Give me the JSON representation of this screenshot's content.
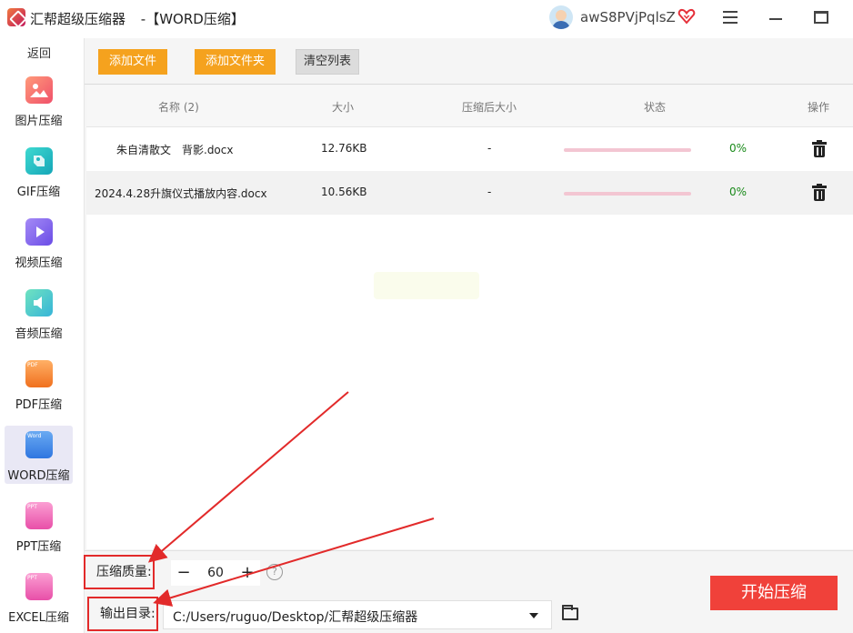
{
  "titlebar": {
    "app_name": "汇帮超级压缩器",
    "mode": "-【WORD压缩】",
    "username": "awS8PVjPqlsZ"
  },
  "sidebar": {
    "back_label": "返回",
    "items": [
      {
        "label": "图片压缩",
        "icon": "image-icon",
        "color": "#f47c6c"
      },
      {
        "label": "GIF压缩",
        "icon": "gif-icon",
        "color": "#2ec5c0"
      },
      {
        "label": "视频压缩",
        "icon": "video-icon",
        "color": "#8b6cf0"
      },
      {
        "label": "音频压缩",
        "icon": "audio-icon",
        "color": "#4fd0a8"
      },
      {
        "label": "PDF压缩",
        "icon": "pdf-icon",
        "color": "#f5892e",
        "tag": "PDF"
      },
      {
        "label": "WORD压缩",
        "icon": "word-icon",
        "color": "#3d8ae8",
        "tag": "Word",
        "active": true
      },
      {
        "label": "PPT压缩",
        "icon": "ppt-icon",
        "color": "#f06cb5",
        "tag": "PPT"
      },
      {
        "label": "EXCEL压缩",
        "icon": "excel-icon",
        "color": "#f06cb5",
        "tag": "PPT"
      }
    ]
  },
  "toolbar": {
    "add_file": "添加文件",
    "add_folder": "添加文件夹",
    "clear_list": "清空列表"
  },
  "table": {
    "headers": {
      "name": "名称 (2)",
      "size": "大小",
      "compressed_size": "压缩后大小",
      "status": "状态",
      "action": "操作"
    },
    "rows": [
      {
        "name": "朱自清散文　背影.docx",
        "size": "12.76KB",
        "compressed": "-",
        "progress": 0,
        "percent": "0%"
      },
      {
        "name": "2024.4.28升旗仪式播放内容.docx",
        "size": "10.56KB",
        "compressed": "-",
        "progress": 0,
        "percent": "0%"
      }
    ]
  },
  "bottom": {
    "quality_label": "压缩质量:",
    "quality_value": "60",
    "minus": "−",
    "plus": "+",
    "help": "?",
    "output_label": "输出目录:",
    "output_path": "C:/Users/ruguo/Desktop/汇帮超级压缩器",
    "start_label": "开始压缩"
  },
  "colors": {
    "accent_orange": "#f5a21e",
    "start_red": "#f0413a",
    "annotation_red": "#e22a2a",
    "status_green": "#1a8a1a"
  }
}
